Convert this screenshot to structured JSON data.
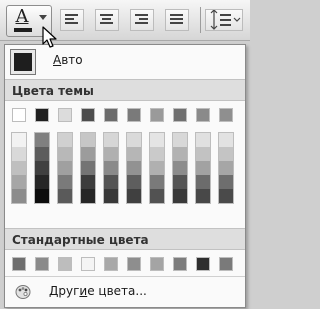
{
  "ribbon": {
    "font_color_letter": "A"
  },
  "menu": {
    "auto_label_prefix": "",
    "auto_label_hotkey": "А",
    "auto_label_rest": "вто",
    "theme_colors_header": "Цвета темы",
    "standard_colors_header": "Стандартные цвета",
    "more_colors_prefix": "Друг",
    "more_colors_hotkey": "и",
    "more_colors_rest": "е цвета..."
  },
  "colors": {
    "auto_swatch": "#1e1e1e",
    "theme_row": [
      "#ffffff",
      "#1f1f1f",
      "#dcdcdc",
      "#4d4d4d",
      "#6b6b6b",
      "#7a7a7a",
      "#9a9a9a",
      "#707070",
      "#8a8a8a",
      "#8f8f8f"
    ],
    "theme_shades": [
      [
        "#f2f2f2",
        "#d9d9d9",
        "#bfbfbf",
        "#a6a6a6",
        "#8c8c8c"
      ],
      [
        "#808080",
        "#5c5c5c",
        "#404040",
        "#262626",
        "#0d0d0d"
      ],
      [
        "#d0d0d0",
        "#b8b8b8",
        "#a0a0a0",
        "#7a7a7a",
        "#5a5a5a"
      ],
      [
        "#c6c6c6",
        "#9c9c9c",
        "#747474",
        "#3c3c3c",
        "#262626"
      ],
      [
        "#d6d6d6",
        "#b0b0b0",
        "#8a8a8a",
        "#545454",
        "#383838"
      ],
      [
        "#dadada",
        "#b6b6b6",
        "#929292",
        "#5e5e5e",
        "#404040"
      ],
      [
        "#e4e4e4",
        "#cacaca",
        "#b0b0b0",
        "#7a7a7a",
        "#525252"
      ],
      [
        "#d8d8d8",
        "#b2b2b2",
        "#8c8c8c",
        "#555555",
        "#393939"
      ],
      [
        "#e0e0e0",
        "#c2c2c2",
        "#a2a2a2",
        "#6c6c6c",
        "#484848"
      ],
      [
        "#e2e2e2",
        "#c4c4c4",
        "#a6a6a6",
        "#6e6e6e",
        "#4a4a4a"
      ]
    ],
    "standard_row": [
      "#6e6e6e",
      "#8a8a8a",
      "#bdbdbd",
      "#f4f4f4",
      "#a8a8a8",
      "#8e8e8e",
      "#a4a4a4",
      "#7c7c7c",
      "#2e2e2e",
      "#7a7a7a"
    ]
  }
}
